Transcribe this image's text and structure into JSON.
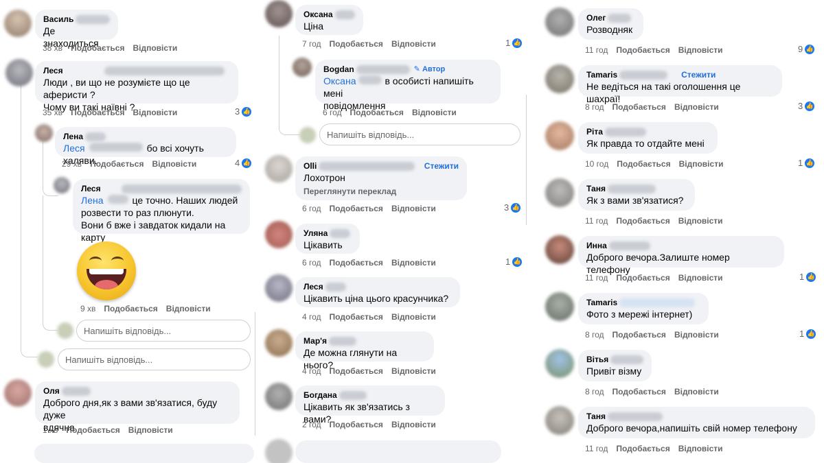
{
  "actions": {
    "like": "Подобається",
    "reply": "Відповісти"
  },
  "reply_placeholder": "Напишіть відповідь...",
  "follow": "Стежити",
  "author_badge": "Автор",
  "translate": "Переглянути переклад",
  "colors": {
    "link": "#216fdb",
    "bubble": "#f0f2f5",
    "like": "#1877f2",
    "meta": "#65676b"
  },
  "col1": [
    {
      "name": "Василь",
      "text": "Де знаходиться",
      "time": "38 хв"
    },
    {
      "name": "Леся",
      "text": "Люди , ви що не розумієте що це аферисти ?\nЧому ви такі наївні ?",
      "time": "35 хв",
      "reactions": "3"
    },
    {
      "name": "Лена",
      "mention": "Леся",
      "text": "бо всі хочуть халяви.",
      "time": "29 хв",
      "reactions": "4"
    },
    {
      "name": "Леся",
      "mention": "Лена",
      "text": "це точно. Наших людей",
      "text2": "розвести то раз плюнути.\nВони б вже і завдаток кидали на карту",
      "time": "9 хв"
    },
    {
      "name": "Оля",
      "text": "Доброго дня,як з вами зв'язатися, буду дуже\nвдячна",
      "time": "1 хв"
    }
  ],
  "col2": [
    {
      "name": "Оксана",
      "text": "Ціна",
      "time": "7 год",
      "reactions": "1"
    },
    {
      "name": "Bogdan",
      "mention": "Оксана",
      "text": "в особисті напишіть мені",
      "text2": "повідомлення",
      "time": "6 год"
    },
    {
      "name": "Olli",
      "text": "Лохотрон",
      "time": "6 год",
      "reactions": "3"
    },
    {
      "name": "Уляна",
      "text": "Цікавить",
      "time": "6 год",
      "reactions": "1"
    },
    {
      "name": "Леся",
      "text": "Цікавить ціна цього красунчика?",
      "time": "4 год"
    },
    {
      "name": "Мар'я",
      "text": "Де можна глянути на нього?",
      "time": "4 год"
    },
    {
      "name": "Богдана",
      "text": "Цікавить як зв'язатись з вами?",
      "time": "2 год"
    }
  ],
  "col3": [
    {
      "name": "Олег",
      "text": "Розводняк",
      "time": "11 год",
      "reactions": "9"
    },
    {
      "name": "Tamaris",
      "text": "Не ведіться на такі оголошення це шахраї!",
      "time": "8 год",
      "reactions": "3"
    },
    {
      "name": "Ріта",
      "text": "Як правда то отдайте мені",
      "time": "10 год",
      "reactions": "1"
    },
    {
      "name": "Таня",
      "text": "Як з вами зв'язатися?",
      "time": "11 год"
    },
    {
      "name": "Инна",
      "text": "Доброго вечора.Залиште номер телефону",
      "time": "11 год",
      "reactions": "1"
    },
    {
      "name": "Tamaris",
      "text": "Фото з мережі інтернет)",
      "time": "8 год",
      "reactions": "1"
    },
    {
      "name": "Вітья",
      "text": "Привіт візму",
      "time": "8 год"
    },
    {
      "name": "Таня",
      "text": "Доброго вечора,напишіть свій номер телефону",
      "time": "11 год"
    }
  ]
}
